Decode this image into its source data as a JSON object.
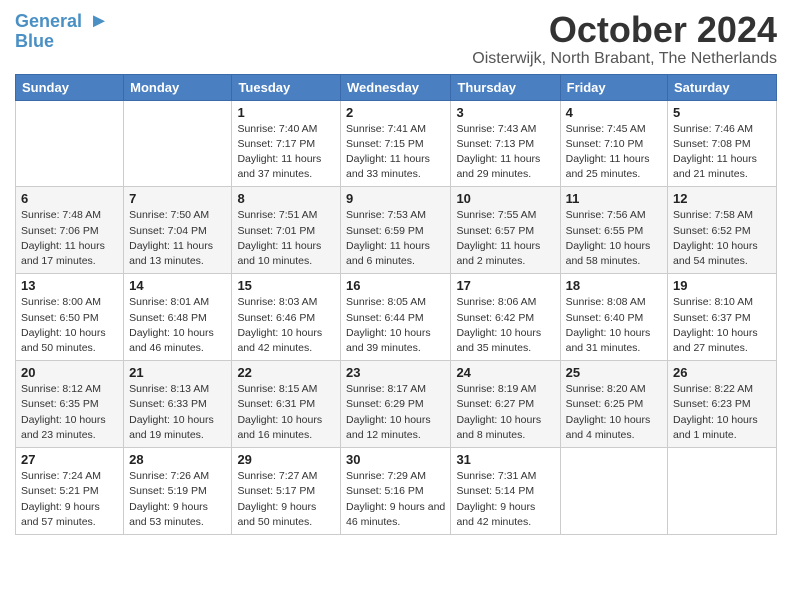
{
  "logo": {
    "line1": "General",
    "line2": "Blue"
  },
  "title": "October 2024",
  "location": "Oisterwijk, North Brabant, The Netherlands",
  "days_header": [
    "Sunday",
    "Monday",
    "Tuesday",
    "Wednesday",
    "Thursday",
    "Friday",
    "Saturday"
  ],
  "weeks": [
    [
      {
        "num": "",
        "info": ""
      },
      {
        "num": "",
        "info": ""
      },
      {
        "num": "1",
        "info": "Sunrise: 7:40 AM\nSunset: 7:17 PM\nDaylight: 11 hours and 37 minutes."
      },
      {
        "num": "2",
        "info": "Sunrise: 7:41 AM\nSunset: 7:15 PM\nDaylight: 11 hours and 33 minutes."
      },
      {
        "num": "3",
        "info": "Sunrise: 7:43 AM\nSunset: 7:13 PM\nDaylight: 11 hours and 29 minutes."
      },
      {
        "num": "4",
        "info": "Sunrise: 7:45 AM\nSunset: 7:10 PM\nDaylight: 11 hours and 25 minutes."
      },
      {
        "num": "5",
        "info": "Sunrise: 7:46 AM\nSunset: 7:08 PM\nDaylight: 11 hours and 21 minutes."
      }
    ],
    [
      {
        "num": "6",
        "info": "Sunrise: 7:48 AM\nSunset: 7:06 PM\nDaylight: 11 hours and 17 minutes."
      },
      {
        "num": "7",
        "info": "Sunrise: 7:50 AM\nSunset: 7:04 PM\nDaylight: 11 hours and 13 minutes."
      },
      {
        "num": "8",
        "info": "Sunrise: 7:51 AM\nSunset: 7:01 PM\nDaylight: 11 hours and 10 minutes."
      },
      {
        "num": "9",
        "info": "Sunrise: 7:53 AM\nSunset: 6:59 PM\nDaylight: 11 hours and 6 minutes."
      },
      {
        "num": "10",
        "info": "Sunrise: 7:55 AM\nSunset: 6:57 PM\nDaylight: 11 hours and 2 minutes."
      },
      {
        "num": "11",
        "info": "Sunrise: 7:56 AM\nSunset: 6:55 PM\nDaylight: 10 hours and 58 minutes."
      },
      {
        "num": "12",
        "info": "Sunrise: 7:58 AM\nSunset: 6:52 PM\nDaylight: 10 hours and 54 minutes."
      }
    ],
    [
      {
        "num": "13",
        "info": "Sunrise: 8:00 AM\nSunset: 6:50 PM\nDaylight: 10 hours and 50 minutes."
      },
      {
        "num": "14",
        "info": "Sunrise: 8:01 AM\nSunset: 6:48 PM\nDaylight: 10 hours and 46 minutes."
      },
      {
        "num": "15",
        "info": "Sunrise: 8:03 AM\nSunset: 6:46 PM\nDaylight: 10 hours and 42 minutes."
      },
      {
        "num": "16",
        "info": "Sunrise: 8:05 AM\nSunset: 6:44 PM\nDaylight: 10 hours and 39 minutes."
      },
      {
        "num": "17",
        "info": "Sunrise: 8:06 AM\nSunset: 6:42 PM\nDaylight: 10 hours and 35 minutes."
      },
      {
        "num": "18",
        "info": "Sunrise: 8:08 AM\nSunset: 6:40 PM\nDaylight: 10 hours and 31 minutes."
      },
      {
        "num": "19",
        "info": "Sunrise: 8:10 AM\nSunset: 6:37 PM\nDaylight: 10 hours and 27 minutes."
      }
    ],
    [
      {
        "num": "20",
        "info": "Sunrise: 8:12 AM\nSunset: 6:35 PM\nDaylight: 10 hours and 23 minutes."
      },
      {
        "num": "21",
        "info": "Sunrise: 8:13 AM\nSunset: 6:33 PM\nDaylight: 10 hours and 19 minutes."
      },
      {
        "num": "22",
        "info": "Sunrise: 8:15 AM\nSunset: 6:31 PM\nDaylight: 10 hours and 16 minutes."
      },
      {
        "num": "23",
        "info": "Sunrise: 8:17 AM\nSunset: 6:29 PM\nDaylight: 10 hours and 12 minutes."
      },
      {
        "num": "24",
        "info": "Sunrise: 8:19 AM\nSunset: 6:27 PM\nDaylight: 10 hours and 8 minutes."
      },
      {
        "num": "25",
        "info": "Sunrise: 8:20 AM\nSunset: 6:25 PM\nDaylight: 10 hours and 4 minutes."
      },
      {
        "num": "26",
        "info": "Sunrise: 8:22 AM\nSunset: 6:23 PM\nDaylight: 10 hours and 1 minute."
      }
    ],
    [
      {
        "num": "27",
        "info": "Sunrise: 7:24 AM\nSunset: 5:21 PM\nDaylight: 9 hours and 57 minutes."
      },
      {
        "num": "28",
        "info": "Sunrise: 7:26 AM\nSunset: 5:19 PM\nDaylight: 9 hours and 53 minutes."
      },
      {
        "num": "29",
        "info": "Sunrise: 7:27 AM\nSunset: 5:17 PM\nDaylight: 9 hours and 50 minutes."
      },
      {
        "num": "30",
        "info": "Sunrise: 7:29 AM\nSunset: 5:16 PM\nDaylight: 9 hours and 46 minutes."
      },
      {
        "num": "31",
        "info": "Sunrise: 7:31 AM\nSunset: 5:14 PM\nDaylight: 9 hours and 42 minutes."
      },
      {
        "num": "",
        "info": ""
      },
      {
        "num": "",
        "info": ""
      }
    ]
  ]
}
